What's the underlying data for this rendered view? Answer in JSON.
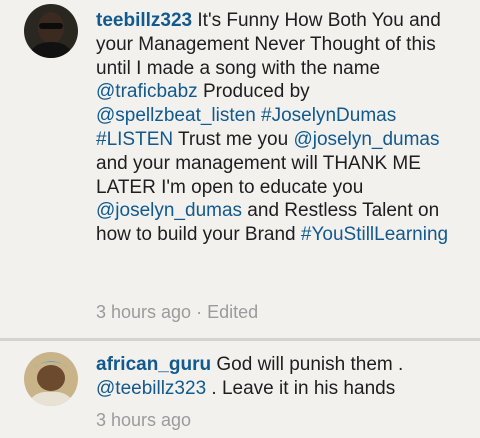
{
  "comments": [
    {
      "username": "teebillz323",
      "avatar": "avatar-man-sunglasses",
      "parts": [
        {
          "t": "text",
          "v": "It's  Funny How Both You and your Management Never Thought of this until I made a song with the name "
        },
        {
          "t": "link",
          "v": "@traficbabz"
        },
        {
          "t": "text",
          "v": " Produced by "
        },
        {
          "t": "link",
          "v": "@spellzbeat_listen"
        },
        {
          "t": "text",
          "v": " "
        },
        {
          "t": "link",
          "v": "#JoselynDumas"
        },
        {
          "t": "text",
          "v": " "
        },
        {
          "t": "link",
          "v": "#LISTEN"
        },
        {
          "t": "text",
          "v": " Trust me you "
        },
        {
          "t": "link",
          "v": "@joselyn_dumas"
        },
        {
          "t": "text",
          "v": " and your management will THANK ME LATER I'm open to educate you "
        },
        {
          "t": "link",
          "v": "@joselyn_dumas"
        },
        {
          "t": "text",
          "v": " and Restless Talent on how to build your Brand "
        },
        {
          "t": "link",
          "v": "#YouStillLearning"
        }
      ],
      "time": "3 hours ago",
      "separator": "·",
      "edited": "Edited"
    },
    {
      "username": "african_guru",
      "avatar": "avatar-baby",
      "parts": [
        {
          "t": "text",
          "v": "God will punish them . "
        },
        {
          "t": "link",
          "v": "@teebillz323"
        },
        {
          "t": "text",
          "v": " . Leave it in his hands"
        }
      ],
      "time": "3 hours ago"
    }
  ],
  "colors": {
    "link": "#12598d",
    "meta": "#9b9b9b",
    "background": "#f2f1ee"
  }
}
